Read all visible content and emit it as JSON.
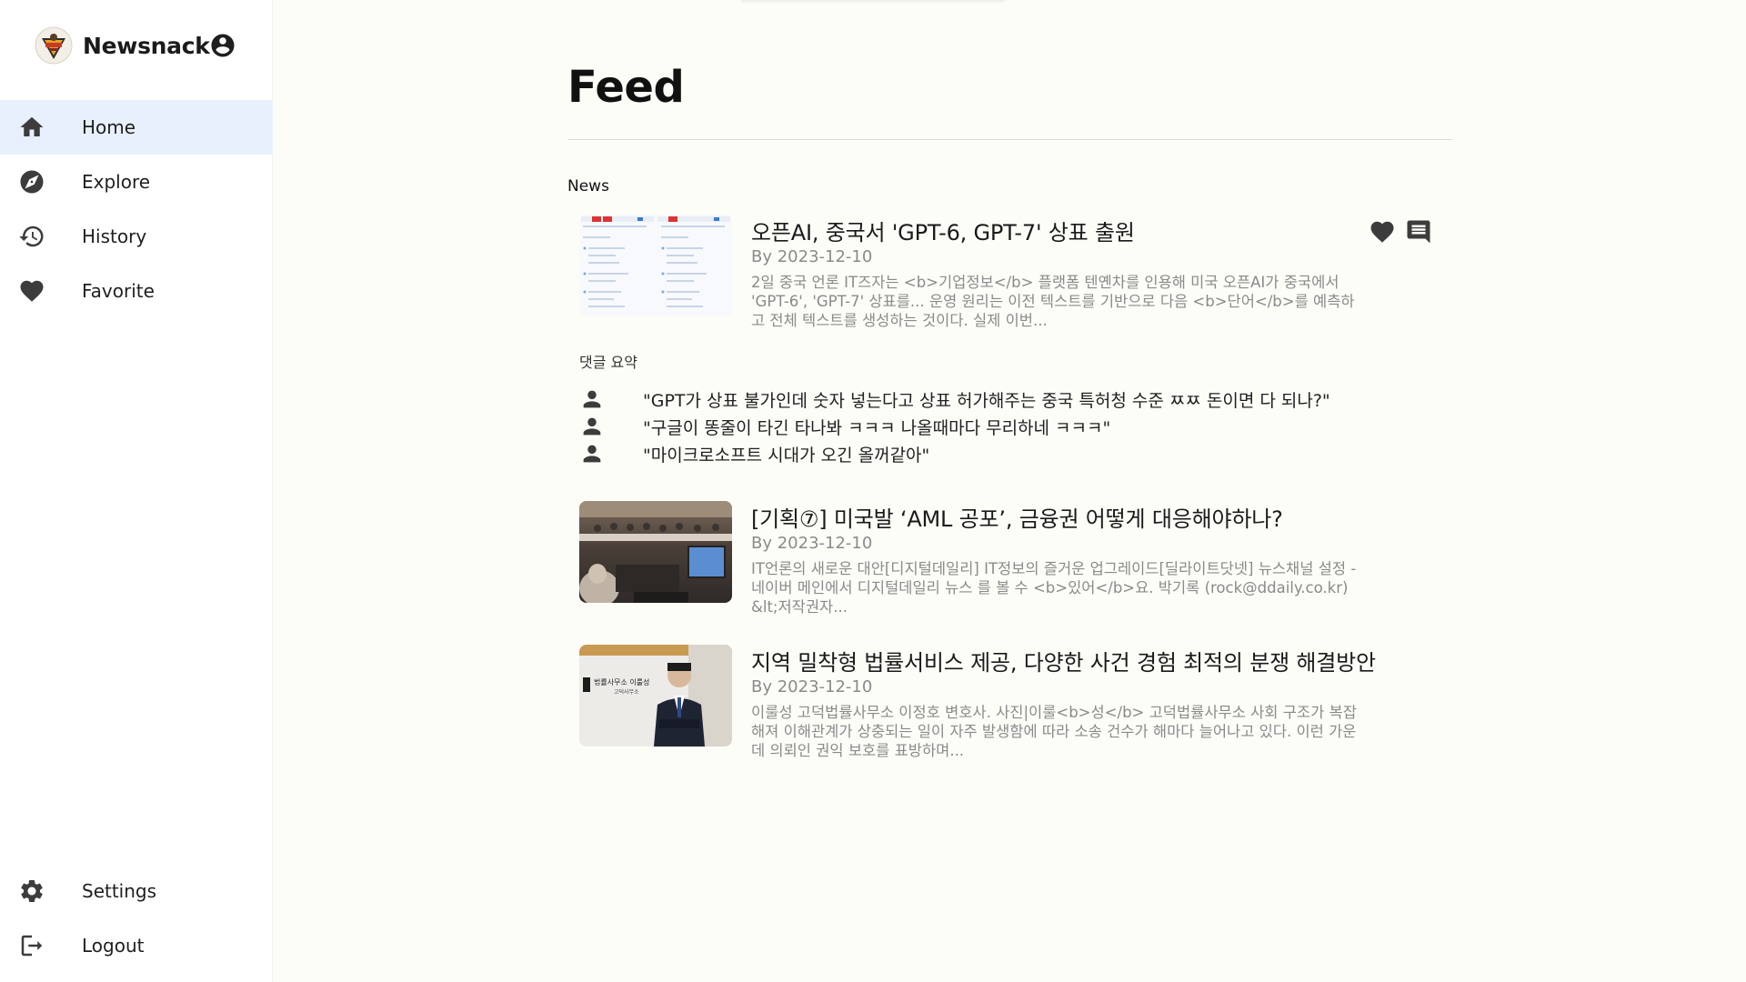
{
  "app": {
    "name": "Newsnack"
  },
  "sidebar": {
    "items": [
      {
        "label": "Home",
        "icon": "home-icon",
        "active": true
      },
      {
        "label": "Explore",
        "icon": "compass-icon",
        "active": false
      },
      {
        "label": "History",
        "icon": "history-icon",
        "active": false
      },
      {
        "label": "Favorite",
        "icon": "heart-icon",
        "active": false
      }
    ],
    "bottom_items": [
      {
        "label": "Settings",
        "icon": "gear-icon"
      },
      {
        "label": "Logout",
        "icon": "logout-icon"
      }
    ]
  },
  "main": {
    "title": "Feed",
    "section_label": "News",
    "comment_summary_label": "댓글 요약",
    "articles": [
      {
        "title": "오픈AI, 중국서 'GPT-6, GPT-7' 상표 출원",
        "date": "By 2023-12-10",
        "description": "2일 중국 언론 IT즈자는 <b>기업정보</b> 플랫폼 텐옌차를 인용해 미국 오픈AI가 중국에서 'GPT-6', 'GPT-7' 상표를... 운영 원리는 이전 텍스트를 기반으로 다음 <b>단어</b>를 예측하고 전체 텍스트를 생성하는 것이다. 실제 이번..."
      },
      {
        "title": "[기획⑦] 미국발 ‘AML 공포’, 금융권 어떻게 대응해야하나?",
        "date": "By 2023-12-10",
        "description": "IT언론의 새로운 대안[디지털데일리] IT정보의 즐거운 업그레이드[딜라이트닷넷] 뉴스채널 설정 - 네이버 메인에서 디지털데일리 뉴스 를 볼 수 <b>있어</b>요. 박기록 (rock@ddaily.co.kr) &lt;저작권자..."
      },
      {
        "title": "지역 밀착형 법률서비스 제공, 다양한 사건 경험 최적의 분쟁 해결방안",
        "date": "By 2023-12-10",
        "description": "이룰성 고덕법률사무소 이정호 변호사. 사진|이룰<b>성</b> 고덕법률사무소 사회 구조가 복잡해져 이해관계가 상충되는 일이 자주 발생함에 따라 소송 건수가 해마다 늘어나고 있다. 이런 가운데 의뢰인 권익 보호를 표방하며...",
        "sign_text": "법률사무소 이룰성",
        "sign_subtext": "고덕사무소"
      }
    ],
    "comments": [
      "\"GPT가 상표 불가인데 숫자 넣는다고 상표 허가해주는 중국 특허청 수준 ㅉㅉ 돈이면 다 되나?\"",
      "\"구글이 똥줄이 타긴 타나봐 ㅋㅋㅋ 나올때마다 무리하네 ㅋㅋㅋ\"",
      "\"마이크로소프트 시대가 오긴 올꺼같아\""
    ]
  },
  "colors": {
    "background": "#fdfdf8",
    "active_nav": "#e8f0fd",
    "icon": "#3c3c3c",
    "muted_text": "#8a8a8a"
  }
}
